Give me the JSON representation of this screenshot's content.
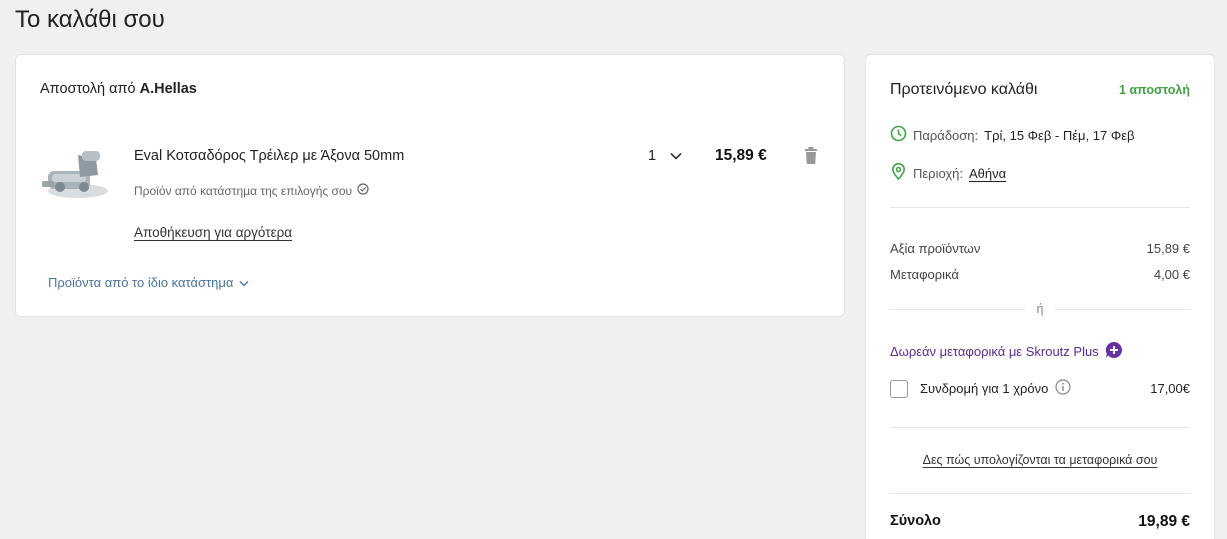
{
  "page": {
    "title": "Το καλάθι σου"
  },
  "cart": {
    "shipping_prefix": "Αποστολή από",
    "store_name": "A.Hellas",
    "item": {
      "name": "Eval Κοτσαδόρος Τρέιλερ με Άξονα 50mm",
      "store_choice_note": "Προϊόν από κατάστημα της επιλογής σου",
      "quantity": "1",
      "price": "15,89 €",
      "save_later": "Αποθήκευση για αργότερα"
    },
    "same_store_link": "Προϊόντα από το ίδιο κατάστημα"
  },
  "summary": {
    "title": "Προτεινόμενο καλάθι",
    "shipments": "1 αποστολή",
    "delivery_label": "Παράδοση:",
    "delivery_value": "Τρί, 15 Φεβ - Πέμ, 17 Φεβ",
    "area_label": "Περιοχή:",
    "area_value": "Αθήνα",
    "products_label": "Αξία προϊόντων",
    "products_value": "15,89 €",
    "shipping_label": "Μεταφορικά",
    "shipping_value": "4,00 €",
    "or_text": "ή",
    "plus_link": "Δωρεάν μεταφορικά με Skroutz Plus",
    "subscription_label": "Συνδρομή για 1 χρόνο",
    "subscription_price": "17,00€",
    "calc_link": "Δες πώς υπολογίζονται τα μεταφορικά σου",
    "total_label": "Σύνολο",
    "total_value": "19,89 €"
  },
  "colors": {
    "accent_green": "#43a047",
    "plus_purple": "#5b2b8a",
    "link_blue": "#4c7396"
  }
}
